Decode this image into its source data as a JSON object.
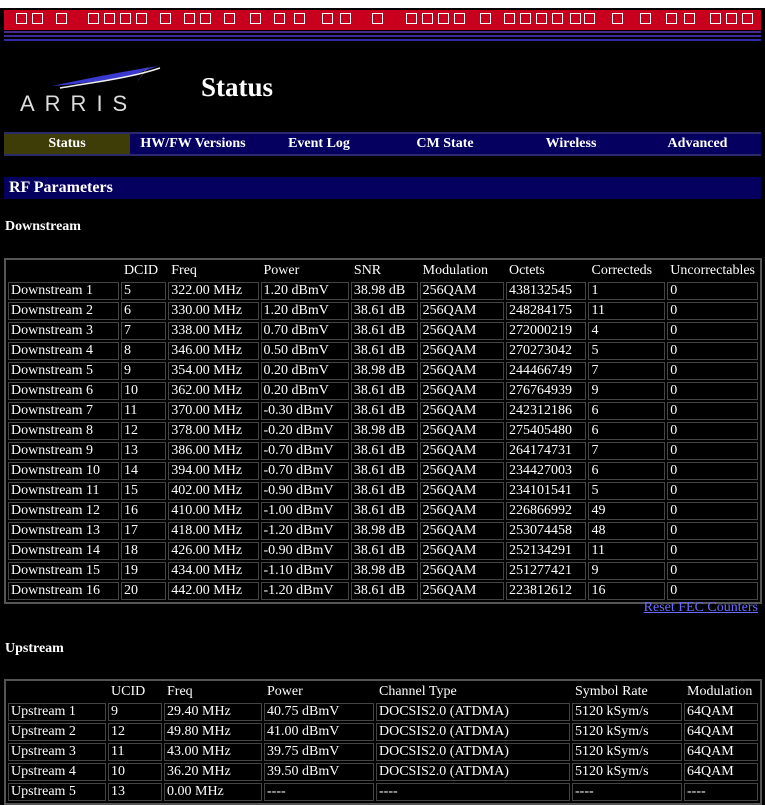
{
  "header": {
    "brand": "ARRIS",
    "title": "Status"
  },
  "nav": {
    "tabs": [
      {
        "label": "Status",
        "active": true
      },
      {
        "label": "HW/FW Versions",
        "active": false
      },
      {
        "label": "Event Log",
        "active": false
      },
      {
        "label": "CM State",
        "active": false
      },
      {
        "label": "Wireless",
        "active": false
      },
      {
        "label": "Advanced",
        "active": false
      }
    ]
  },
  "section": {
    "title": "RF Parameters"
  },
  "downstream": {
    "heading": "Downstream",
    "columns": [
      "",
      "DCID",
      "Freq",
      "Power",
      "SNR",
      "Modulation",
      "Octets",
      "Correcteds",
      "Uncorrectables"
    ],
    "rows": [
      [
        "Downstream 1",
        "5",
        "322.00 MHz",
        "1.20 dBmV",
        "38.98 dB",
        "256QAM",
        "438132545",
        "1",
        "0"
      ],
      [
        "Downstream 2",
        "6",
        "330.00 MHz",
        "1.20 dBmV",
        "38.61 dB",
        "256QAM",
        "248284175",
        "11",
        "0"
      ],
      [
        "Downstream 3",
        "7",
        "338.00 MHz",
        "0.70 dBmV",
        "38.61 dB",
        "256QAM",
        "272000219",
        "4",
        "0"
      ],
      [
        "Downstream 4",
        "8",
        "346.00 MHz",
        "0.50 dBmV",
        "38.61 dB",
        "256QAM",
        "270273042",
        "5",
        "0"
      ],
      [
        "Downstream 5",
        "9",
        "354.00 MHz",
        "0.20 dBmV",
        "38.98 dB",
        "256QAM",
        "244466749",
        "7",
        "0"
      ],
      [
        "Downstream 6",
        "10",
        "362.00 MHz",
        "0.20 dBmV",
        "38.61 dB",
        "256QAM",
        "276764939",
        "9",
        "0"
      ],
      [
        "Downstream 7",
        "11",
        "370.00 MHz",
        "-0.30 dBmV",
        "38.61 dB",
        "256QAM",
        "242312186",
        "6",
        "0"
      ],
      [
        "Downstream 8",
        "12",
        "378.00 MHz",
        "-0.20 dBmV",
        "38.98 dB",
        "256QAM",
        "275405480",
        "6",
        "0"
      ],
      [
        "Downstream 9",
        "13",
        "386.00 MHz",
        "-0.70 dBmV",
        "38.61 dB",
        "256QAM",
        "264174731",
        "7",
        "0"
      ],
      [
        "Downstream 10",
        "14",
        "394.00 MHz",
        "-0.70 dBmV",
        "38.61 dB",
        "256QAM",
        "234427003",
        "6",
        "0"
      ],
      [
        "Downstream 11",
        "15",
        "402.00 MHz",
        "-0.90 dBmV",
        "38.61 dB",
        "256QAM",
        "234101541",
        "5",
        "0"
      ],
      [
        "Downstream 12",
        "16",
        "410.00 MHz",
        "-1.00 dBmV",
        "38.61 dB",
        "256QAM",
        "226866992",
        "49",
        "0"
      ],
      [
        "Downstream 13",
        "17",
        "418.00 MHz",
        "-1.20 dBmV",
        "38.98 dB",
        "256QAM",
        "253074458",
        "48",
        "0"
      ],
      [
        "Downstream 14",
        "18",
        "426.00 MHz",
        "-0.90 dBmV",
        "38.61 dB",
        "256QAM",
        "252134291",
        "11",
        "0"
      ],
      [
        "Downstream 15",
        "19",
        "434.00 MHz",
        "-1.10 dBmV",
        "38.98 dB",
        "256QAM",
        "251277421",
        "9",
        "0"
      ],
      [
        "Downstream 16",
        "20",
        "442.00 MHz",
        "-1.20 dBmV",
        "38.61 dB",
        "256QAM",
        "223812612",
        "16",
        "0"
      ]
    ],
    "reset_link": "Reset FEC Counters"
  },
  "upstream": {
    "heading": "Upstream",
    "columns": [
      "",
      "UCID",
      "Freq",
      "Power",
      "Channel Type",
      "Symbol Rate",
      "Modulation"
    ],
    "rows": [
      [
        "Upstream 1",
        "9",
        "29.40 MHz",
        "40.75 dBmV",
        "DOCSIS2.0 (ATDMA)",
        "5120 kSym/s",
        "64QAM"
      ],
      [
        "Upstream 2",
        "12",
        "49.80 MHz",
        "41.00 dBmV",
        "DOCSIS2.0 (ATDMA)",
        "5120 kSym/s",
        "64QAM"
      ],
      [
        "Upstream 3",
        "11",
        "43.00 MHz",
        "39.75 dBmV",
        "DOCSIS2.0 (ATDMA)",
        "5120 kSym/s",
        "64QAM"
      ],
      [
        "Upstream 4",
        "10",
        "36.20 MHz",
        "39.50 dBmV",
        "DOCSIS2.0 (ATDMA)",
        "5120 kSym/s",
        "64QAM"
      ],
      [
        "Upstream 5",
        "13",
        "0.00 MHz",
        "----",
        "----",
        "----",
        "----"
      ]
    ]
  },
  "colors": {
    "top_band": "#c8001e",
    "nav_bg": "#050060",
    "nav_active": "#3e3d08",
    "link": "#6b6bff"
  }
}
